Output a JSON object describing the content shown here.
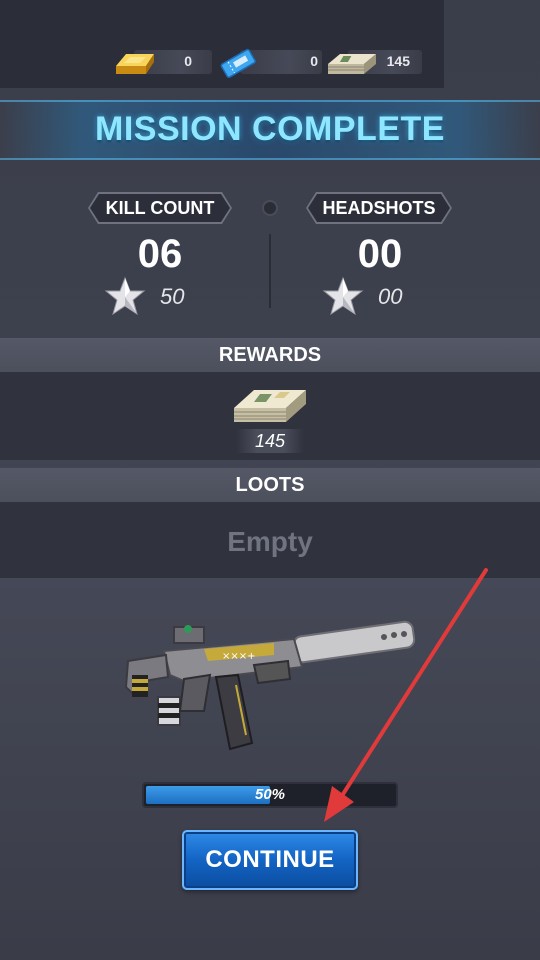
{
  "currencies": [
    {
      "name": "gold",
      "icon": "gold-bar-icon",
      "value": "0"
    },
    {
      "name": "ticket",
      "icon": "ticket-icon",
      "value": "0"
    },
    {
      "name": "cash",
      "icon": "cash-stack-icon",
      "value": "145"
    }
  ],
  "banner": {
    "title": "MISSION COMPLETE"
  },
  "stats": {
    "kill": {
      "label": "KILL COUNT",
      "value": "06",
      "score": "50"
    },
    "headshots": {
      "label": "HEADSHOTS",
      "value": "00",
      "score": "00"
    }
  },
  "rewards": {
    "title": "REWARDS",
    "item_icon": "cash-stack-icon",
    "item_value": "145"
  },
  "loots": {
    "title": "LOOTS",
    "empty_text": "Empty"
  },
  "weapon": {
    "icon": "submachine-gun-icon",
    "progress": 0.5,
    "progress_label": "50%"
  },
  "continue_label": "CONTINUE",
  "colors": {
    "accent_blue": "#1d6fc2",
    "banner_text": "#8fe6ff",
    "arrow": "#e03a3a"
  }
}
